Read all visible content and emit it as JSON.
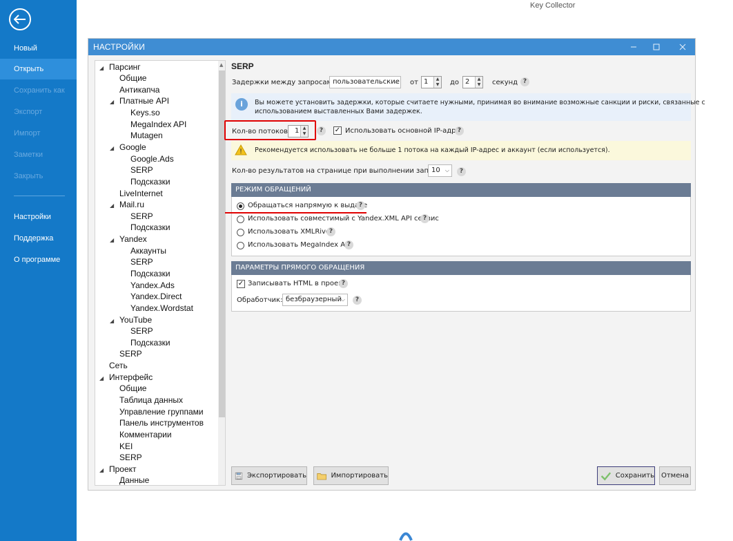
{
  "app": {
    "title": "Key Collector"
  },
  "backstage": {
    "items": [
      {
        "label": "Новый",
        "state": "normal"
      },
      {
        "label": "Открыть",
        "state": "active"
      },
      {
        "label": "Сохранить как",
        "state": "disabled"
      },
      {
        "label": "Экспорт",
        "state": "disabled"
      },
      {
        "label": "Импорт",
        "state": "disabled"
      },
      {
        "label": "Заметки",
        "state": "disabled"
      },
      {
        "label": "Закрыть",
        "state": "disabled"
      }
    ],
    "items2": [
      {
        "label": "Настройки"
      },
      {
        "label": "Поддержка"
      },
      {
        "label": "О программе"
      }
    ]
  },
  "dialog": {
    "title": "НАСТРОЙКИ",
    "tree": [
      "Парсинг",
      "Общие",
      "Антикапча",
      "Платные API",
      "Keys.so",
      "MegaIndex API",
      "Mutagen",
      "Google",
      "Google.Ads",
      "SERP",
      "Подсказки",
      "LiveInternet",
      "Mail.ru",
      "SERP",
      "Подсказки",
      "Yandex",
      "Аккаунты",
      "SERP",
      "Подсказки",
      "Yandex.Ads",
      "Yandex.Direct",
      "Yandex.Wordstat",
      "YouTube",
      "SERP",
      "Подсказки",
      "SERP",
      "Сеть",
      "Интерфейс",
      "Общие",
      "Таблица данных",
      "Управление группами",
      "Панель инструментов",
      "Комментарии",
      "KEI",
      "SERP",
      "Проект",
      "Данные"
    ],
    "section_title": "SERP",
    "delays": {
      "label": "Задержки между запросами:",
      "mode": "пользовательские",
      "from_label": "от",
      "from_value": "1",
      "to_label": "до",
      "to_value": "2",
      "unit": "секунд"
    },
    "info_text_1": "Вы можете установить задержки, которые считаете нужными, принимая во внимание возможные санкции и риски, связанные с",
    "info_text_2": "использованием выставленных Вами задержек.",
    "threads": {
      "label": "Кол-во потоков:",
      "value": "1"
    },
    "use_main_ip": {
      "label": "Использовать основной IP-адрес",
      "checked": true
    },
    "warning_text": "Рекомендуется использовать не больше 1 потока на каждый IP-адрес и аккаунт (если используется).",
    "results_per_page": {
      "label": "Кол-во результатов на странице при выполнении запросов:",
      "value": "10"
    },
    "mode_group": {
      "title": "РЕЖИМ ОБРАЩЕНИЙ",
      "options": [
        {
          "label": "Обращаться напрямую к выдаче",
          "selected": true
        },
        {
          "label": "Использовать совместимый с Yandex.XML API сервис",
          "selected": false
        },
        {
          "label": "Использовать XMLRiver",
          "selected": false
        },
        {
          "label": "Использовать MegaIndex API",
          "selected": false
        }
      ]
    },
    "direct_group": {
      "title": "ПАРАМЕТРЫ ПРЯМОГО ОБРАЩЕНИЯ",
      "write_html": {
        "label": "Записывать HTML в проект",
        "checked": true
      },
      "handler_label": "Обработчик:",
      "handler_value": "безбраузерный"
    },
    "buttons": {
      "export": "Экспортировать",
      "import": "Импортировать",
      "save": "Сохранить",
      "cancel": "Отмена"
    },
    "help_glyph": "?"
  },
  "colors": {
    "backstage": "#1479c8",
    "titlebar": "#3f8dd3",
    "group_header": "#6b7c94",
    "highlight": "#e00000"
  }
}
